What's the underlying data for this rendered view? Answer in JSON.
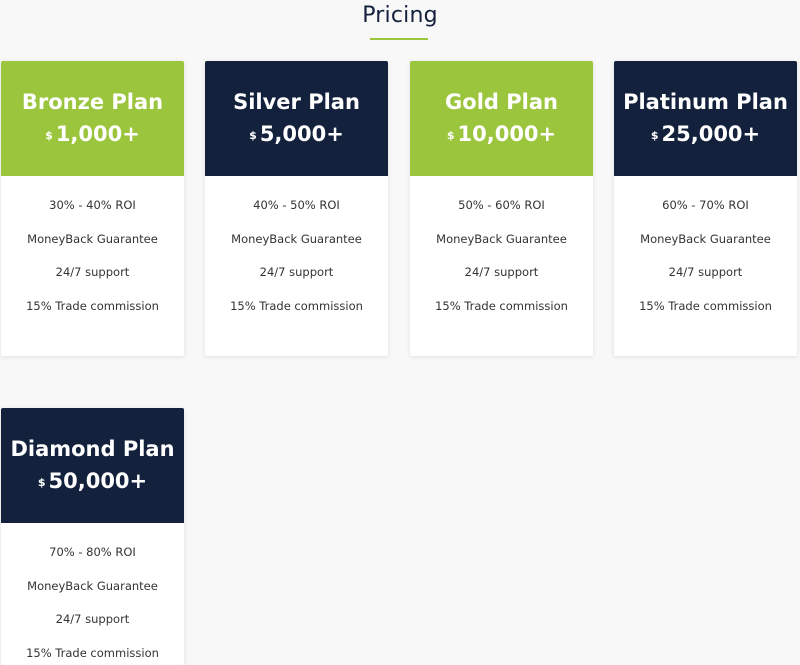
{
  "section": {
    "title": "Pricing",
    "accent_color": "#9bc53d",
    "navy_color": "#13213d"
  },
  "plans": [
    {
      "name": "Bronze Plan",
      "currency": "$",
      "price": "1,000+",
      "theme": "green",
      "features": [
        "30% - 40% ROI",
        "MoneyBack Guarantee",
        "24/7 support",
        "15% Trade commission"
      ]
    },
    {
      "name": "Silver Plan",
      "currency": "$",
      "price": "5,000+",
      "theme": "navy",
      "features": [
        "40% - 50% ROI",
        "MoneyBack Guarantee",
        "24/7 support",
        "15% Trade commission"
      ]
    },
    {
      "name": "Gold Plan",
      "currency": "$",
      "price": "10,000+",
      "theme": "green",
      "features": [
        "50% - 60% ROI",
        "MoneyBack Guarantee",
        "24/7 support",
        "15% Trade commission"
      ]
    },
    {
      "name": "Platinum Plan",
      "currency": "$",
      "price": "25,000+",
      "theme": "navy",
      "features": [
        "60% - 70% ROI",
        "MoneyBack Guarantee",
        "24/7 support",
        "15% Trade commission"
      ]
    },
    {
      "name": "Diamond Plan",
      "currency": "$",
      "price": "50,000+",
      "theme": "navy",
      "features": [
        "70% - 80% ROI",
        "MoneyBack Guarantee",
        "24/7 support",
        "15% Trade commission"
      ]
    }
  ]
}
